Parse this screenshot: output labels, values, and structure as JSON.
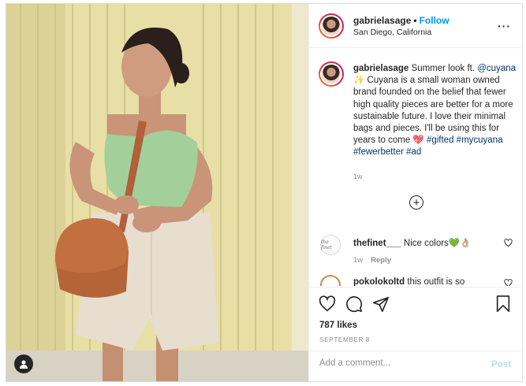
{
  "post": {
    "username": "gabrielasage",
    "dot": "•",
    "follow_label": "Follow",
    "location": "San Diego, California",
    "more_icon": "more-horizontal-icon"
  },
  "caption": {
    "username": "gabrielasage",
    "text_1": " Summer look ft. ",
    "mention": "@cuyana",
    "text_2": " ✨ Cuyana is a small woman owned brand founded on the belief that fewer high quality pieces are better for a more sustainable future. I love their minimal bags and pieces. I'll be using this for years to come 💖 ",
    "tag_1": "#gifted",
    "tag_2": "#mycuyana",
    "tag_3": "#fewerbetter",
    "tag_4": "#ad",
    "time": "1w"
  },
  "load_more_icon": "plus-circle-icon",
  "comments": [
    {
      "username": "thefinet___",
      "text": " Nice colors💚👌🏼",
      "time": "1w",
      "reply_label": "Reply",
      "avatar_text": "the finet"
    },
    {
      "username": "pokolokoltd",
      "text": " this outfit is so",
      "time": "",
      "reply_label": "",
      "avatar_text": ""
    }
  ],
  "actions": {
    "like_icon": "heart-icon",
    "comment_icon": "comment-icon",
    "share_icon": "share-icon",
    "save_icon": "bookmark-icon",
    "likes": "787 likes",
    "date": "SEPTEMBER 8"
  },
  "add_comment": {
    "placeholder": "Add a comment...",
    "post_label": "Post"
  },
  "colors": {
    "accent": "#0095f6",
    "link": "#00376b",
    "muted": "#8e8e8e",
    "post_disabled": "#b2dffc"
  }
}
